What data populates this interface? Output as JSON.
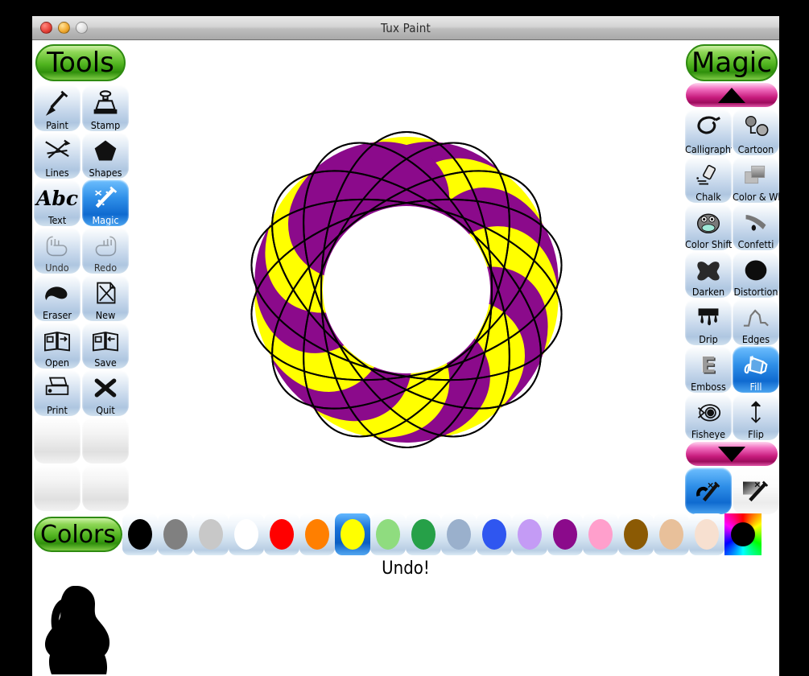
{
  "window": {
    "title": "Tux Paint",
    "traffic_lights": [
      "close-light",
      "minimize-light",
      "maximize-light"
    ]
  },
  "tools_panel": {
    "heading": "Tools",
    "items": [
      {
        "label": "Paint",
        "icon": "paintbrush-icon",
        "state": "normal"
      },
      {
        "label": "Stamp",
        "icon": "stamp-icon",
        "state": "normal"
      },
      {
        "label": "Lines",
        "icon": "lines-icon",
        "state": "normal"
      },
      {
        "label": "Shapes",
        "icon": "pentagon-icon",
        "state": "normal"
      },
      {
        "label": "Text",
        "icon": "abc-text-icon",
        "state": "normal"
      },
      {
        "label": "Magic",
        "icon": "magic-wand-icon",
        "state": "selected"
      },
      {
        "label": "Undo",
        "icon": "undo-hand-icon",
        "state": "disabled"
      },
      {
        "label": "Redo",
        "icon": "redo-hand-icon",
        "state": "disabled"
      },
      {
        "label": "Eraser",
        "icon": "eraser-icon",
        "state": "normal"
      },
      {
        "label": "New",
        "icon": "new-page-icon",
        "state": "normal"
      },
      {
        "label": "Open",
        "icon": "open-book-icon",
        "state": "normal"
      },
      {
        "label": "Save",
        "icon": "save-book-icon",
        "state": "normal"
      },
      {
        "label": "Print",
        "icon": "printer-icon",
        "state": "normal"
      },
      {
        "label": "Quit",
        "icon": "quit-x-icon",
        "state": "normal"
      },
      {
        "label": "",
        "icon": "empty-slot",
        "state": "blank"
      },
      {
        "label": "",
        "icon": "empty-slot",
        "state": "blank"
      },
      {
        "label": "",
        "icon": "empty-slot",
        "state": "blank"
      },
      {
        "label": "",
        "icon": "empty-slot",
        "state": "blank"
      }
    ]
  },
  "magic_panel": {
    "heading": "Magic",
    "scroll_up": "scroll-up-arrow",
    "scroll_down": "scroll-down-arrow",
    "items": [
      {
        "label": "Calligraphy",
        "icon": "calligraphy-icon",
        "state": "normal"
      },
      {
        "label": "Cartoon",
        "icon": "cartoon-icon",
        "state": "normal"
      },
      {
        "label": "Chalk",
        "icon": "chalk-icon",
        "state": "normal"
      },
      {
        "label": "Color & White",
        "icon": "color-and-white-icon",
        "state": "normal"
      },
      {
        "label": "Color Shift",
        "icon": "color-shift-icon",
        "state": "normal"
      },
      {
        "label": "Confetti",
        "icon": "confetti-icon",
        "state": "normal"
      },
      {
        "label": "Darken",
        "icon": "darken-icon",
        "state": "normal"
      },
      {
        "label": "Distortion",
        "icon": "distortion-icon",
        "state": "normal"
      },
      {
        "label": "Drip",
        "icon": "drip-icon",
        "state": "normal"
      },
      {
        "label": "Edges",
        "icon": "edges-icon",
        "state": "normal"
      },
      {
        "label": "Emboss",
        "icon": "emboss-icon",
        "state": "normal"
      },
      {
        "label": "Fill",
        "icon": "fill-bucket-icon",
        "state": "selected"
      },
      {
        "label": "Fisheye",
        "icon": "fisheye-icon",
        "state": "normal"
      },
      {
        "label": "Flip",
        "icon": "flip-icon",
        "state": "normal"
      }
    ],
    "extra_items": [
      {
        "label": "",
        "icon": "paint-magic-blue-icon",
        "state": "selected-blue"
      },
      {
        "label": "",
        "icon": "paint-magic-white-icon",
        "state": "white"
      }
    ]
  },
  "colors_panel": {
    "heading": "Colors",
    "selected_index": 6,
    "swatches": [
      {
        "name": "black",
        "hex": "#000000"
      },
      {
        "name": "dark-grey",
        "hex": "#808080"
      },
      {
        "name": "light-grey",
        "hex": "#c8c8c8"
      },
      {
        "name": "white",
        "hex": "#ffffff"
      },
      {
        "name": "red",
        "hex": "#ff0000"
      },
      {
        "name": "orange",
        "hex": "#ff7f00"
      },
      {
        "name": "yellow",
        "hex": "#ffff00"
      },
      {
        "name": "light-green",
        "hex": "#8fdc7f"
      },
      {
        "name": "green",
        "hex": "#26a048"
      },
      {
        "name": "slate-blue",
        "hex": "#9ab0cc"
      },
      {
        "name": "blue",
        "hex": "#2f56f0"
      },
      {
        "name": "lavender",
        "hex": "#c49bf5"
      },
      {
        "name": "purple",
        "hex": "#8b0a8b"
      },
      {
        "name": "pink",
        "hex": "#ff9fcc"
      },
      {
        "name": "brown",
        "hex": "#8b5a04"
      },
      {
        "name": "tan",
        "hex": "#e8c09a"
      },
      {
        "name": "cream",
        "hex": "#f7e0d0"
      },
      {
        "name": "color-picker",
        "hex": "rainbow"
      }
    ]
  },
  "status": {
    "message": "Undo!",
    "mascot": "tux-penguin-silhouette"
  },
  "canvas": {
    "artwork_name": "spirograph-rosette",
    "background": "#ffffff",
    "petal_count": 14,
    "fill_colors": [
      "#ffff00",
      "#8b0a8b"
    ],
    "outline_color": "#000000"
  }
}
